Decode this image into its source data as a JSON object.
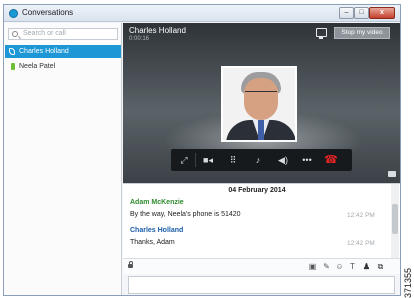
{
  "window": {
    "title": "Conversations",
    "controls": {
      "minimize": "–",
      "maximize": "□",
      "close": "x"
    }
  },
  "sidebar": {
    "search_placeholder": "Search or call",
    "contacts": [
      {
        "name": "Charles Holland",
        "active": true,
        "icon": "phone-icon"
      },
      {
        "name": "Neela Patel",
        "active": false,
        "icon": "presence-icon",
        "status_color": "#6fbe37"
      }
    ]
  },
  "call": {
    "contact_name": "Charles Holland",
    "timer": "0:00:16",
    "stop_video_label": "Stop my video",
    "controls": [
      {
        "name": "fullscreen-icon",
        "glyph": "⤢"
      },
      {
        "name": "camera-icon",
        "glyph": "■◂"
      },
      {
        "name": "keypad-icon",
        "glyph": "⠿"
      },
      {
        "name": "mute-icon",
        "glyph": "♪"
      },
      {
        "name": "volume-icon",
        "glyph": "◀)"
      },
      {
        "name": "more-icon",
        "glyph": "•••"
      },
      {
        "name": "end-call-icon",
        "glyph": "☎",
        "color": "#e32424"
      }
    ]
  },
  "chat": {
    "date": "04 February 2014",
    "messages": [
      {
        "author": "Adam McKenzie",
        "author_color": "#2f8a2f",
        "text": "By the way, Neela's phone is 51420",
        "time": "12:42 PM"
      },
      {
        "author": "Charles Holland",
        "author_color": "#1b5da8",
        "text": "Thanks, Adam",
        "time": "12:42 PM"
      }
    ],
    "toolbar_icons": [
      "screenshot-icon",
      "attach-icon",
      "emoticon-icon",
      "font-icon",
      "add-participant-icon",
      "popout-icon"
    ],
    "compose_value": ""
  },
  "figure_id": "371355"
}
